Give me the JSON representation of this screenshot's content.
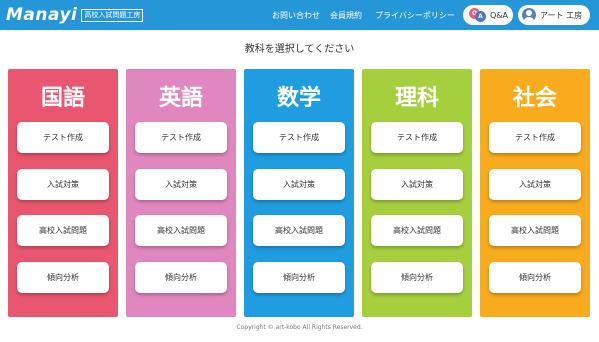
{
  "header": {
    "logo": "Manayi",
    "logo_sub": "高校入試問題工房",
    "nav": [
      "お問い合わせ",
      "会員規約",
      "プライバシーポリシー"
    ],
    "qa_label": "Q&A",
    "user_name": "アート 工房",
    "icons": [
      "qa-icon",
      "user-icon"
    ]
  },
  "page_title": "教科を選択してください",
  "subjects": [
    {
      "name": "国語",
      "color": "#e9566f",
      "buttons": [
        "テスト作成",
        "入試対策",
        "高校入試問題",
        "傾向分析"
      ]
    },
    {
      "name": "英語",
      "color": "#e187bf",
      "buttons": [
        "テスト作成",
        "入試対策",
        "高校入試問題",
        "傾向分析"
      ]
    },
    {
      "name": "数学",
      "color": "#1f9de0",
      "buttons": [
        "テスト作成",
        "入試対策",
        "高校入試問題",
        "傾向分析"
      ]
    },
    {
      "name": "理科",
      "color": "#a6cf3e",
      "buttons": [
        "テスト作成",
        "入試対策",
        "高校入試問題",
        "傾向分析"
      ]
    },
    {
      "name": "社会",
      "color": "#f7ab1d",
      "buttons": [
        "テスト作成",
        "入試対策",
        "高校入試問題",
        "傾向分析"
      ]
    }
  ],
  "footer": "Copyright © art-kobo All Rights Reserved.",
  "colors": {
    "header": "#2596d8"
  }
}
